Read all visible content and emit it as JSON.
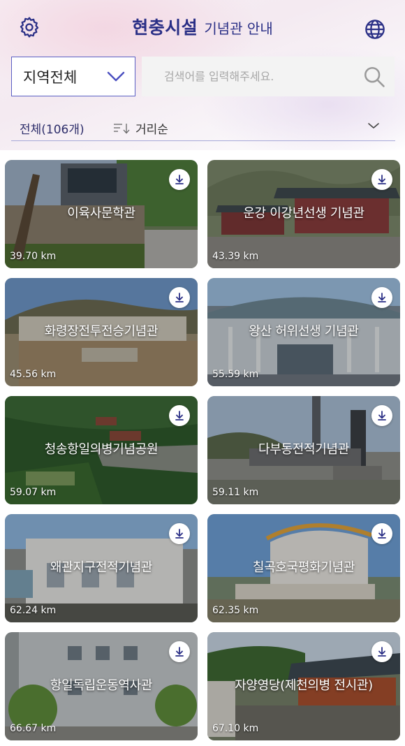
{
  "header": {
    "title_main": "현충시설",
    "title_sub": "기념관 안내",
    "settings_icon": "gear-icon",
    "language_icon": "globe-icon",
    "accent_color": "#2a2f86"
  },
  "filters": {
    "region_selected": "지역전체",
    "search_placeholder": "검색어를 입력해주세요.",
    "search_value": "",
    "count_label": "전체(106개)",
    "sort_label": "거리순"
  },
  "facilities": [
    {
      "name": "이육사문학관",
      "distance": "39.70 km"
    },
    {
      "name": "운강 이강년선생 기념관",
      "distance": "43.39 km"
    },
    {
      "name": "화령장전투전승기념관",
      "distance": "45.56 km"
    },
    {
      "name": "왕산 허위선생 기념관",
      "distance": "55.59 km"
    },
    {
      "name": "청송항일의병기념공원",
      "distance": "59.07 km"
    },
    {
      "name": "다부동전적기념관",
      "distance": "59.11 km"
    },
    {
      "name": "왜관지구전적기념관",
      "distance": "62.24 km"
    },
    {
      "name": "칠곡호국평화기념관",
      "distance": "62.35 km"
    },
    {
      "name": "항일독립운동역사관",
      "distance": "66.67 km"
    },
    {
      "name": "자양영당(제천의병 전시관)",
      "distance": "67.10 km"
    }
  ]
}
